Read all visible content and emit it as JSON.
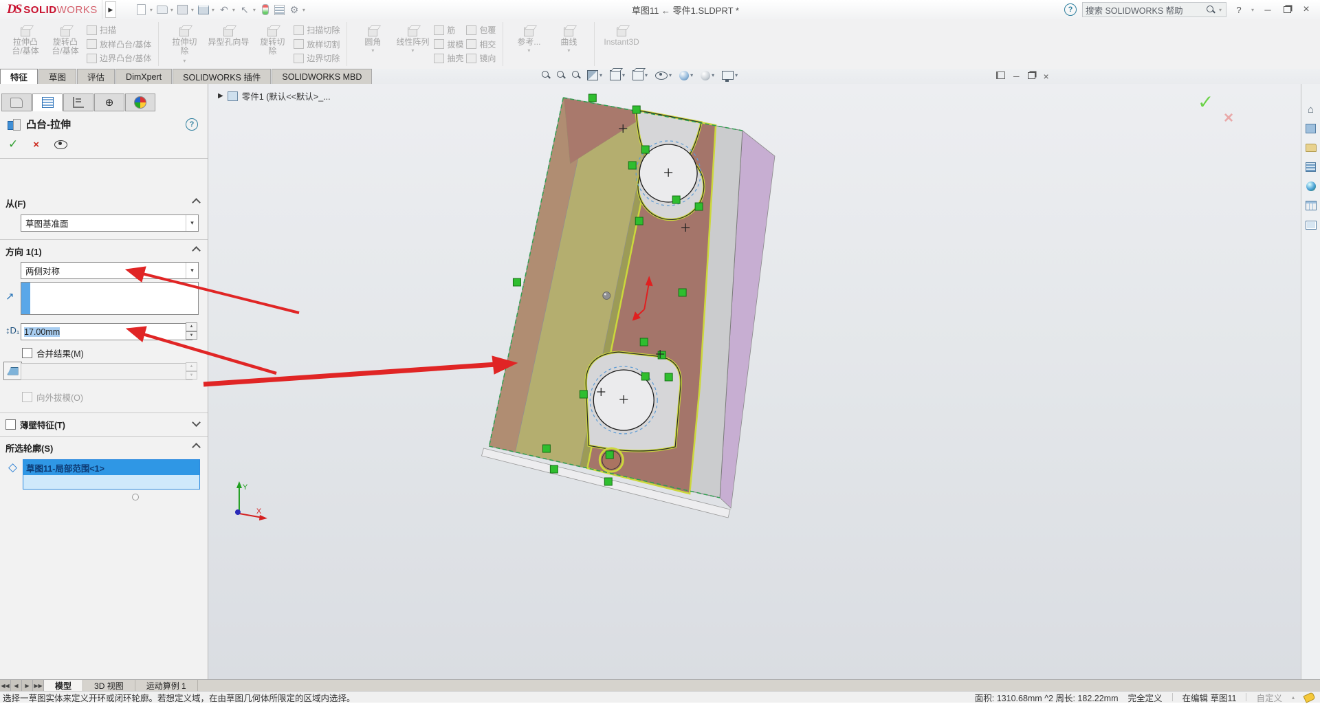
{
  "title_bar": {
    "brand_mark": "DS",
    "brand_solid": "SOLID",
    "brand_works": "WORKS",
    "document_title": "草图11 ← 零件1.SLDPRT *",
    "search_placeholder": "搜索 SOLIDWORKS 帮助",
    "help_label": "?"
  },
  "ribbon": {
    "g1": {
      "b1l1": "拉伸凸",
      "b1l2": "台/基体",
      "b2l1": "旋转凸",
      "b2l2": "台/基体",
      "s1": "扫描",
      "s2": "放样凸台/基体",
      "s3": "边界凸台/基体"
    },
    "g2": {
      "b1l1": "拉伸切",
      "b1l2": "除",
      "b2": "异型孔向导",
      "b3l1": "旋转切",
      "b3l2": "除",
      "s1": "扫描切除",
      "s2": "放样切割",
      "s3": "边界切除"
    },
    "g3": {
      "b1": "圆角",
      "b2": "线性阵列",
      "s1": "筋",
      "s2": "拔模",
      "s3": "抽壳",
      "s4": "包覆",
      "s5": "相交",
      "s6": "镜向"
    },
    "g4": {
      "b1": "参考...",
      "b2": "曲线"
    },
    "g5": {
      "b1": "Instant3D"
    }
  },
  "command_tabs": {
    "t1": "特征",
    "t2": "草图",
    "t3": "评估",
    "t4": "DimXpert",
    "t5": "SOLIDWORKS 插件",
    "t6": "SOLIDWORKS MBD",
    "active": "特征"
  },
  "panel": {
    "title": "凸台-拉伸",
    "help": "?",
    "from_label": "从(F)",
    "from_value": "草图基准面",
    "dir_label": "方向 1(1)",
    "dir_value": "两侧对称",
    "depth_value": "17.00mm",
    "merge_label": "合并结果(M)",
    "draft_out_label": "向外拔模(O)",
    "thin_label": "薄壁特征(T)",
    "contours_label": "所选轮廓(S)",
    "contour_item": "草图11-局部范围<1>"
  },
  "viewport": {
    "tree_item": "零件1 (默认<<默认>_...",
    "axis_x": "X",
    "axis_y": "Y"
  },
  "heads_up_icons": [
    "zoom-fit-icon",
    "zoom-area-icon",
    "previous-view-icon",
    "section-view-icon",
    "view-orientation-icon",
    "display-style-icon",
    "hide-show-icon",
    "appearance-icon",
    "scene-icon",
    "view-settings-icon"
  ],
  "quick_icons": [
    "new-file-icon",
    "open-file-icon",
    "save-icon",
    "print-icon",
    "undo-icon",
    "select-icon",
    "rebuild-icon",
    "options-list-icon",
    "gear-icon"
  ],
  "task_pane_icons": [
    "home-icon",
    "model-cube-icon",
    "folder-icon",
    "design-library-icon",
    "globe-icon",
    "table-icon",
    "screens-icon"
  ],
  "doc_tabs": {
    "t1": "模型",
    "t2": "3D 视图",
    "t3": "运动算例 1",
    "active": "模型"
  },
  "status": {
    "hint": "选择一草图实体来定义开环或闭环轮廓。若想定义域，在由草图几何体所限定的区域内选择。",
    "measurements": "面积: 1310.68mm ^2 周长: 182.22mm",
    "state": "完全定义",
    "editing": "在编辑 草图11",
    "custom": "自定义"
  },
  "colors": {
    "accent_blue": "#2f97e5",
    "marker_green": "#2fbe2f",
    "arrow_red": "#e02525",
    "contour_highlight": "#ccd83c",
    "face_khaki": "#b4ae6f",
    "face_tan": "#b08d72",
    "face_brown": "#a4756a",
    "face_lavender": "#c7aed2",
    "face_gray": "#cbccce"
  }
}
